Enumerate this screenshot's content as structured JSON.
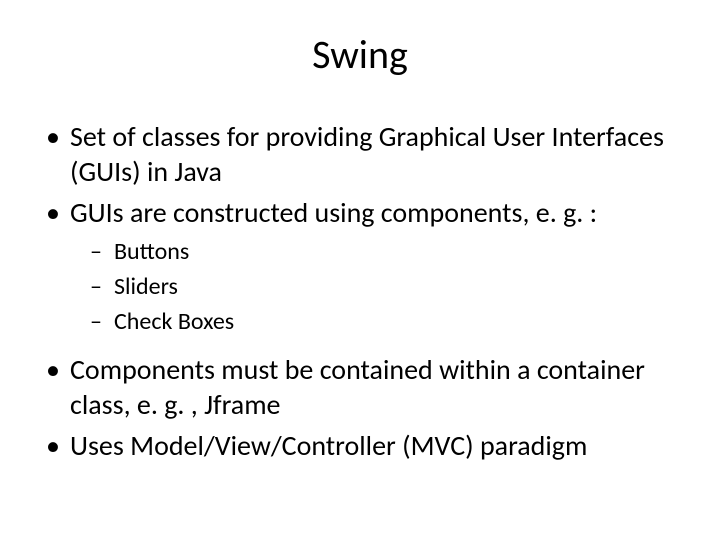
{
  "title": "Swing",
  "bullets": {
    "b1": "Set of classes for providing Graphical User Interfaces (GUIs) in Java",
    "b2": "GUIs are constructed using components, e. g. :",
    "b2_sub": {
      "s1": "Buttons",
      "s2": "Sliders",
      "s3": "Check Boxes"
    },
    "b3": "Components must be contained within a container class, e. g. , Jframe",
    "b4": "Uses Model/View/Controller (MVC) paradigm"
  }
}
